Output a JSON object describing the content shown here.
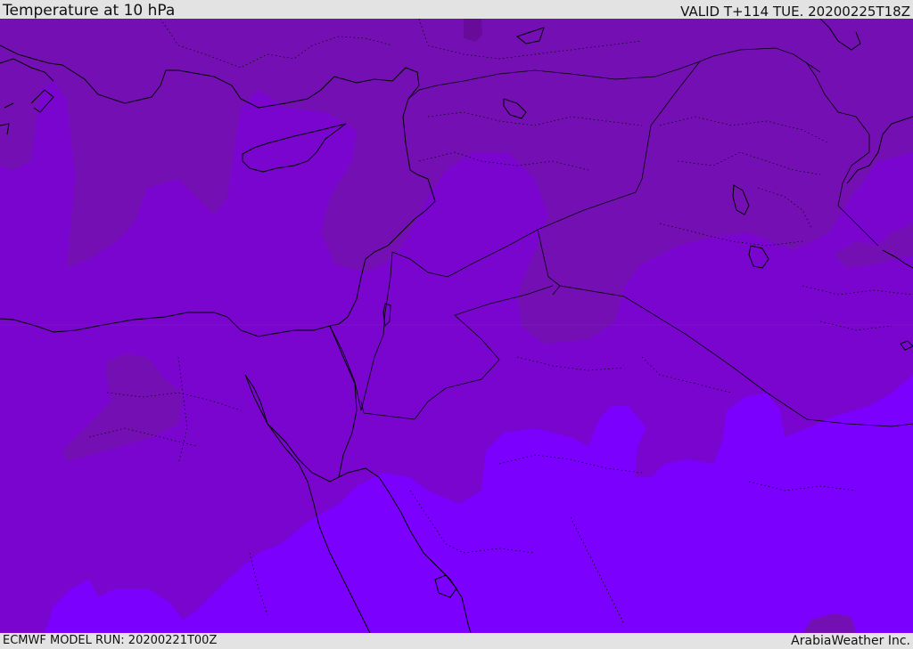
{
  "header": {
    "title": "Temperature at 10 hPa",
    "valid": "VALID T+114 TUE. 20200225T18Z"
  },
  "footer": {
    "model_run": "ECMWF MODEL RUN: 20200221T00Z",
    "provider": "ArabiaWeather Inc."
  },
  "map": {
    "field_colors": {
      "dark_band": "#7410b3",
      "mid_band": "#7a05cf",
      "light_band": "#7b00fe",
      "darkest_spot": "#690b9a",
      "coastline": "#000000"
    }
  }
}
